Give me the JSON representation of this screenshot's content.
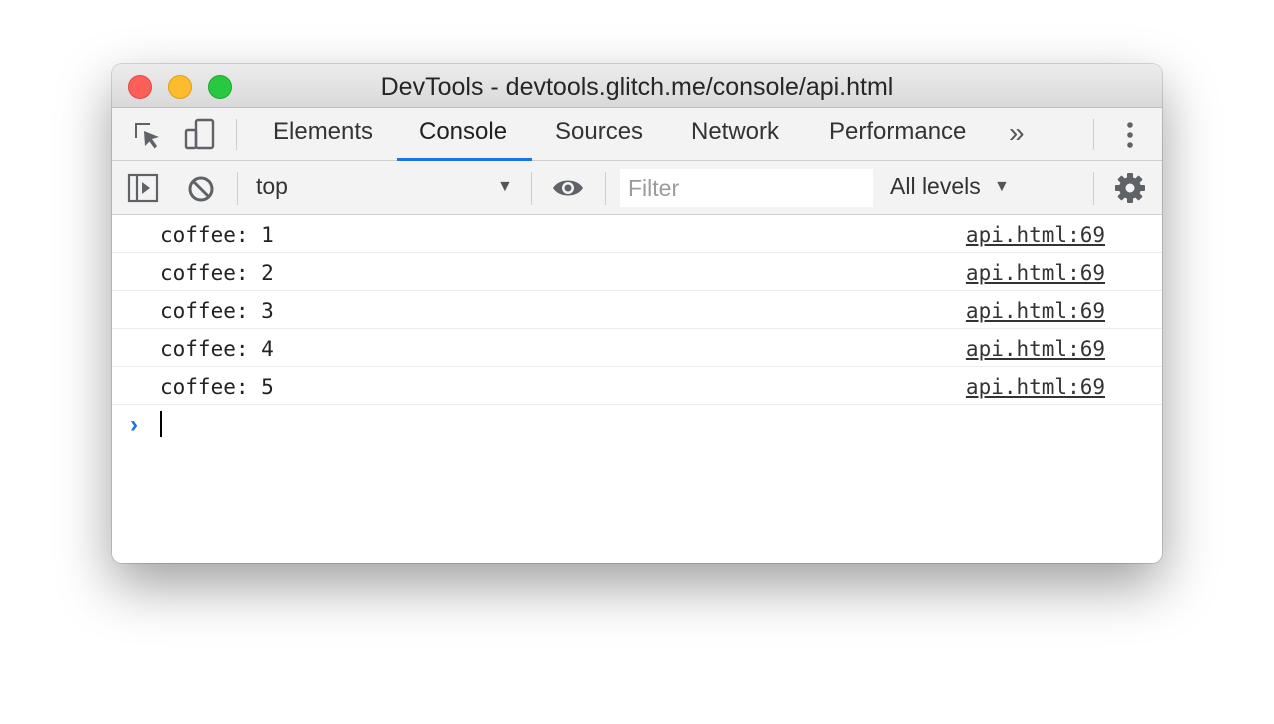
{
  "window": {
    "title": "DevTools - devtools.glitch.me/console/api.html"
  },
  "tabs": [
    {
      "label": "Elements",
      "active": false
    },
    {
      "label": "Console",
      "active": true
    },
    {
      "label": "Sources",
      "active": false
    },
    {
      "label": "Network",
      "active": false
    },
    {
      "label": "Performance",
      "active": false
    }
  ],
  "toolbar": {
    "context": "top",
    "filter_placeholder": "Filter",
    "levels": "All levels"
  },
  "console": {
    "messages": [
      {
        "text": "coffee: 1",
        "source": "api.html:69"
      },
      {
        "text": "coffee: 2",
        "source": "api.html:69"
      },
      {
        "text": "coffee: 3",
        "source": "api.html:69"
      },
      {
        "text": "coffee: 4",
        "source": "api.html:69"
      },
      {
        "text": "coffee: 5",
        "source": "api.html:69"
      }
    ]
  },
  "icons": {
    "inspect": "inspect-element-icon",
    "device": "device-toolbar-icon",
    "more_tabs": "more-tabs-icon",
    "menu": "kebab-menu-icon",
    "sidebar": "sidebar-toggle-icon",
    "clear": "clear-console-icon",
    "live_expression": "eye-icon",
    "settings": "gear-icon",
    "prompt": "prompt-chevron-icon"
  },
  "colors": {
    "accent": "#1a73e8"
  }
}
